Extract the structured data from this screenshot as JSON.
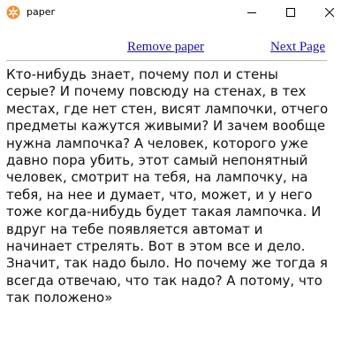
{
  "window": {
    "title": "paper",
    "icon": "orange-flower-app-icon",
    "controls": [
      "minimize",
      "maximize",
      "close"
    ]
  },
  "nav": {
    "remove_label": "Remove paper",
    "next_label": "Next Page"
  },
  "content": {
    "text": "Кто-нибудь знает, почему пол и стены серые? И почему повсюду на стенах, в тех местах, где нет стен, висят лампочки, отчего предметы кажутся живыми? И зачем вообще нужна лампочка? А человек, которого уже давно пора убить, этот самый непонятный человек, смотрит на тебя, на лампочку, на тебя, на нее и думает, что, может, и у него тоже когда-нибудь будет такая лампочка. И вдруг на тебе появляется автомат и начинает стрелять. Вот в этом все и дело. Значит, так надо было. Но почему же тогда я всегда отвечаю, что так надо? А потому, что так положено»"
  },
  "colors": {
    "link": "#1a0dab",
    "text": "#111111",
    "icon_accent": "#f28c28"
  }
}
